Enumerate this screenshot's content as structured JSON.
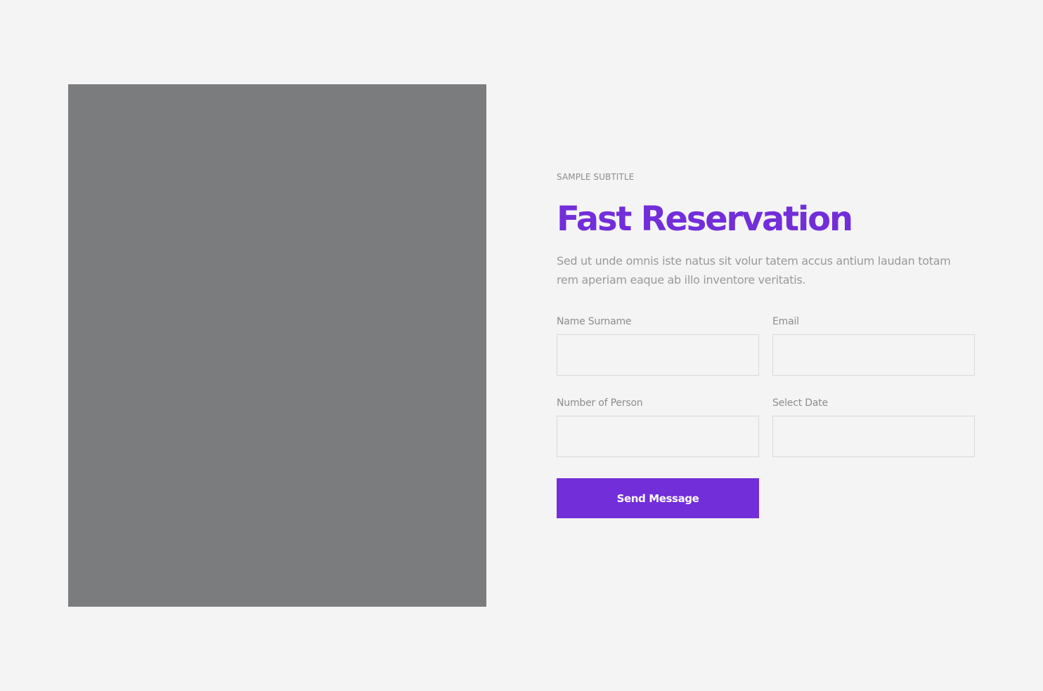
{
  "section": {
    "subtitle": "SAMPLE SUBTITLE",
    "title": "Fast Reservation",
    "description": "Sed ut unde omnis iste natus sit volur tatem accus antium laudan totam rem aperiam eaque ab illo inventore veritatis."
  },
  "form": {
    "fields": [
      {
        "label": "Name Surname",
        "value": "",
        "placeholder": ""
      },
      {
        "label": "Email",
        "value": "",
        "placeholder": ""
      },
      {
        "label": "Number of Person",
        "value": "",
        "placeholder": ""
      },
      {
        "label": "Select Date",
        "value": "",
        "placeholder": ""
      }
    ],
    "submit_label": "Send Message"
  },
  "colors": {
    "accent": "#722ed9",
    "background": "#f4f4f4",
    "image_placeholder": "#7b7c7e",
    "muted_text": "#999999"
  }
}
